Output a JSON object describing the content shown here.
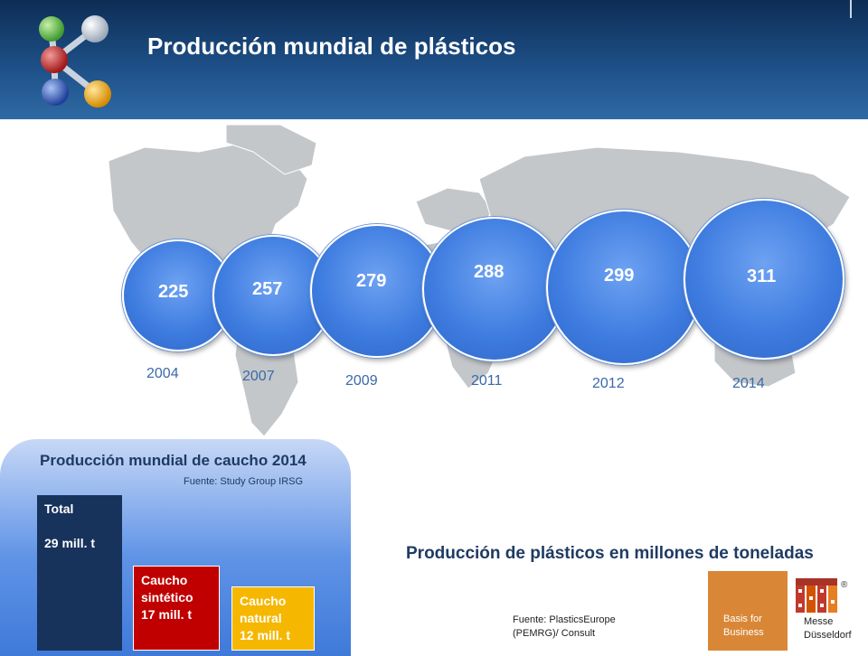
{
  "header": {
    "title": "Producción mundial de plásticos"
  },
  "bubbles": [
    {
      "value": "225",
      "year": "2004"
    },
    {
      "value": "257",
      "year": "2007"
    },
    {
      "value": "279",
      "year": "2009"
    },
    {
      "value": "288",
      "year": "2011"
    },
    {
      "value": "299",
      "year": "2012"
    },
    {
      "value": "311",
      "year": "2014"
    }
  ],
  "rubber": {
    "title": "Producción mundial de caucho 2014",
    "source": "Fuente: Study Group IRSG",
    "total": {
      "label": "Total",
      "value": "29 mill. t"
    },
    "synthetic": {
      "label1": "Caucho",
      "label2": "sintético",
      "value": "17 mill. t"
    },
    "natural": {
      "label1": "Caucho",
      "label2": "natural",
      "value": "12 mill. t"
    }
  },
  "plastics": {
    "caption": "Producción de plásticos en millones de toneladas",
    "source_line1": "Fuente: PlasticsEurope",
    "source_line2": "(PEMRG)/ Consult"
  },
  "logos": {
    "basis_line1": "Basis for",
    "basis_line2": "Business",
    "messe_line1": "Messe",
    "messe_line2": "Düsseldorf",
    "registered": "®"
  },
  "colors": {
    "header": "#1d4f86",
    "bubble": "#3f7de0",
    "total_bar": "#17325b",
    "synthetic_bar": "#c00000",
    "natural_bar": "#f5b700",
    "basis_orange": "#d98737",
    "messe_red": "#c0392b"
  }
}
